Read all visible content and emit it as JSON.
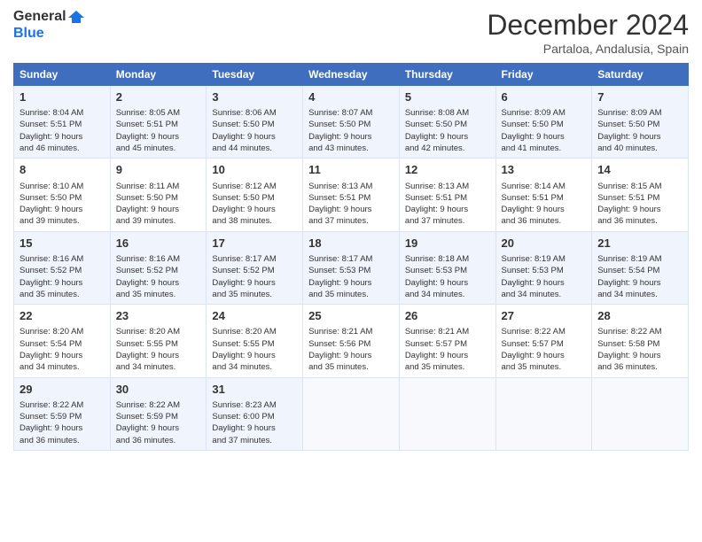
{
  "header": {
    "logo_line1": "General",
    "logo_line2": "Blue",
    "month": "December 2024",
    "location": "Partaloa, Andalusia, Spain"
  },
  "weekdays": [
    "Sunday",
    "Monday",
    "Tuesday",
    "Wednesday",
    "Thursday",
    "Friday",
    "Saturday"
  ],
  "weeks": [
    [
      {
        "day": "1",
        "lines": [
          "Sunrise: 8:04 AM",
          "Sunset: 5:51 PM",
          "Daylight: 9 hours",
          "and 46 minutes."
        ]
      },
      {
        "day": "2",
        "lines": [
          "Sunrise: 8:05 AM",
          "Sunset: 5:51 PM",
          "Daylight: 9 hours",
          "and 45 minutes."
        ]
      },
      {
        "day": "3",
        "lines": [
          "Sunrise: 8:06 AM",
          "Sunset: 5:50 PM",
          "Daylight: 9 hours",
          "and 44 minutes."
        ]
      },
      {
        "day": "4",
        "lines": [
          "Sunrise: 8:07 AM",
          "Sunset: 5:50 PM",
          "Daylight: 9 hours",
          "and 43 minutes."
        ]
      },
      {
        "day": "5",
        "lines": [
          "Sunrise: 8:08 AM",
          "Sunset: 5:50 PM",
          "Daylight: 9 hours",
          "and 42 minutes."
        ]
      },
      {
        "day": "6",
        "lines": [
          "Sunrise: 8:09 AM",
          "Sunset: 5:50 PM",
          "Daylight: 9 hours",
          "and 41 minutes."
        ]
      },
      {
        "day": "7",
        "lines": [
          "Sunrise: 8:09 AM",
          "Sunset: 5:50 PM",
          "Daylight: 9 hours",
          "and 40 minutes."
        ]
      }
    ],
    [
      {
        "day": "8",
        "lines": [
          "Sunrise: 8:10 AM",
          "Sunset: 5:50 PM",
          "Daylight: 9 hours",
          "and 39 minutes."
        ]
      },
      {
        "day": "9",
        "lines": [
          "Sunrise: 8:11 AM",
          "Sunset: 5:50 PM",
          "Daylight: 9 hours",
          "and 39 minutes."
        ]
      },
      {
        "day": "10",
        "lines": [
          "Sunrise: 8:12 AM",
          "Sunset: 5:50 PM",
          "Daylight: 9 hours",
          "and 38 minutes."
        ]
      },
      {
        "day": "11",
        "lines": [
          "Sunrise: 8:13 AM",
          "Sunset: 5:51 PM",
          "Daylight: 9 hours",
          "and 37 minutes."
        ]
      },
      {
        "day": "12",
        "lines": [
          "Sunrise: 8:13 AM",
          "Sunset: 5:51 PM",
          "Daylight: 9 hours",
          "and 37 minutes."
        ]
      },
      {
        "day": "13",
        "lines": [
          "Sunrise: 8:14 AM",
          "Sunset: 5:51 PM",
          "Daylight: 9 hours",
          "and 36 minutes."
        ]
      },
      {
        "day": "14",
        "lines": [
          "Sunrise: 8:15 AM",
          "Sunset: 5:51 PM",
          "Daylight: 9 hours",
          "and 36 minutes."
        ]
      }
    ],
    [
      {
        "day": "15",
        "lines": [
          "Sunrise: 8:16 AM",
          "Sunset: 5:52 PM",
          "Daylight: 9 hours",
          "and 35 minutes."
        ]
      },
      {
        "day": "16",
        "lines": [
          "Sunrise: 8:16 AM",
          "Sunset: 5:52 PM",
          "Daylight: 9 hours",
          "and 35 minutes."
        ]
      },
      {
        "day": "17",
        "lines": [
          "Sunrise: 8:17 AM",
          "Sunset: 5:52 PM",
          "Daylight: 9 hours",
          "and 35 minutes."
        ]
      },
      {
        "day": "18",
        "lines": [
          "Sunrise: 8:17 AM",
          "Sunset: 5:53 PM",
          "Daylight: 9 hours",
          "and 35 minutes."
        ]
      },
      {
        "day": "19",
        "lines": [
          "Sunrise: 8:18 AM",
          "Sunset: 5:53 PM",
          "Daylight: 9 hours",
          "and 34 minutes."
        ]
      },
      {
        "day": "20",
        "lines": [
          "Sunrise: 8:19 AM",
          "Sunset: 5:53 PM",
          "Daylight: 9 hours",
          "and 34 minutes."
        ]
      },
      {
        "day": "21",
        "lines": [
          "Sunrise: 8:19 AM",
          "Sunset: 5:54 PM",
          "Daylight: 9 hours",
          "and 34 minutes."
        ]
      }
    ],
    [
      {
        "day": "22",
        "lines": [
          "Sunrise: 8:20 AM",
          "Sunset: 5:54 PM",
          "Daylight: 9 hours",
          "and 34 minutes."
        ]
      },
      {
        "day": "23",
        "lines": [
          "Sunrise: 8:20 AM",
          "Sunset: 5:55 PM",
          "Daylight: 9 hours",
          "and 34 minutes."
        ]
      },
      {
        "day": "24",
        "lines": [
          "Sunrise: 8:20 AM",
          "Sunset: 5:55 PM",
          "Daylight: 9 hours",
          "and 34 minutes."
        ]
      },
      {
        "day": "25",
        "lines": [
          "Sunrise: 8:21 AM",
          "Sunset: 5:56 PM",
          "Daylight: 9 hours",
          "and 35 minutes."
        ]
      },
      {
        "day": "26",
        "lines": [
          "Sunrise: 8:21 AM",
          "Sunset: 5:57 PM",
          "Daylight: 9 hours",
          "and 35 minutes."
        ]
      },
      {
        "day": "27",
        "lines": [
          "Sunrise: 8:22 AM",
          "Sunset: 5:57 PM",
          "Daylight: 9 hours",
          "and 35 minutes."
        ]
      },
      {
        "day": "28",
        "lines": [
          "Sunrise: 8:22 AM",
          "Sunset: 5:58 PM",
          "Daylight: 9 hours",
          "and 36 minutes."
        ]
      }
    ],
    [
      {
        "day": "29",
        "lines": [
          "Sunrise: 8:22 AM",
          "Sunset: 5:59 PM",
          "Daylight: 9 hours",
          "and 36 minutes."
        ]
      },
      {
        "day": "30",
        "lines": [
          "Sunrise: 8:22 AM",
          "Sunset: 5:59 PM",
          "Daylight: 9 hours",
          "and 36 minutes."
        ]
      },
      {
        "day": "31",
        "lines": [
          "Sunrise: 8:23 AM",
          "Sunset: 6:00 PM",
          "Daylight: 9 hours",
          "and 37 minutes."
        ]
      },
      {
        "day": "",
        "lines": []
      },
      {
        "day": "",
        "lines": []
      },
      {
        "day": "",
        "lines": []
      },
      {
        "day": "",
        "lines": []
      }
    ]
  ]
}
